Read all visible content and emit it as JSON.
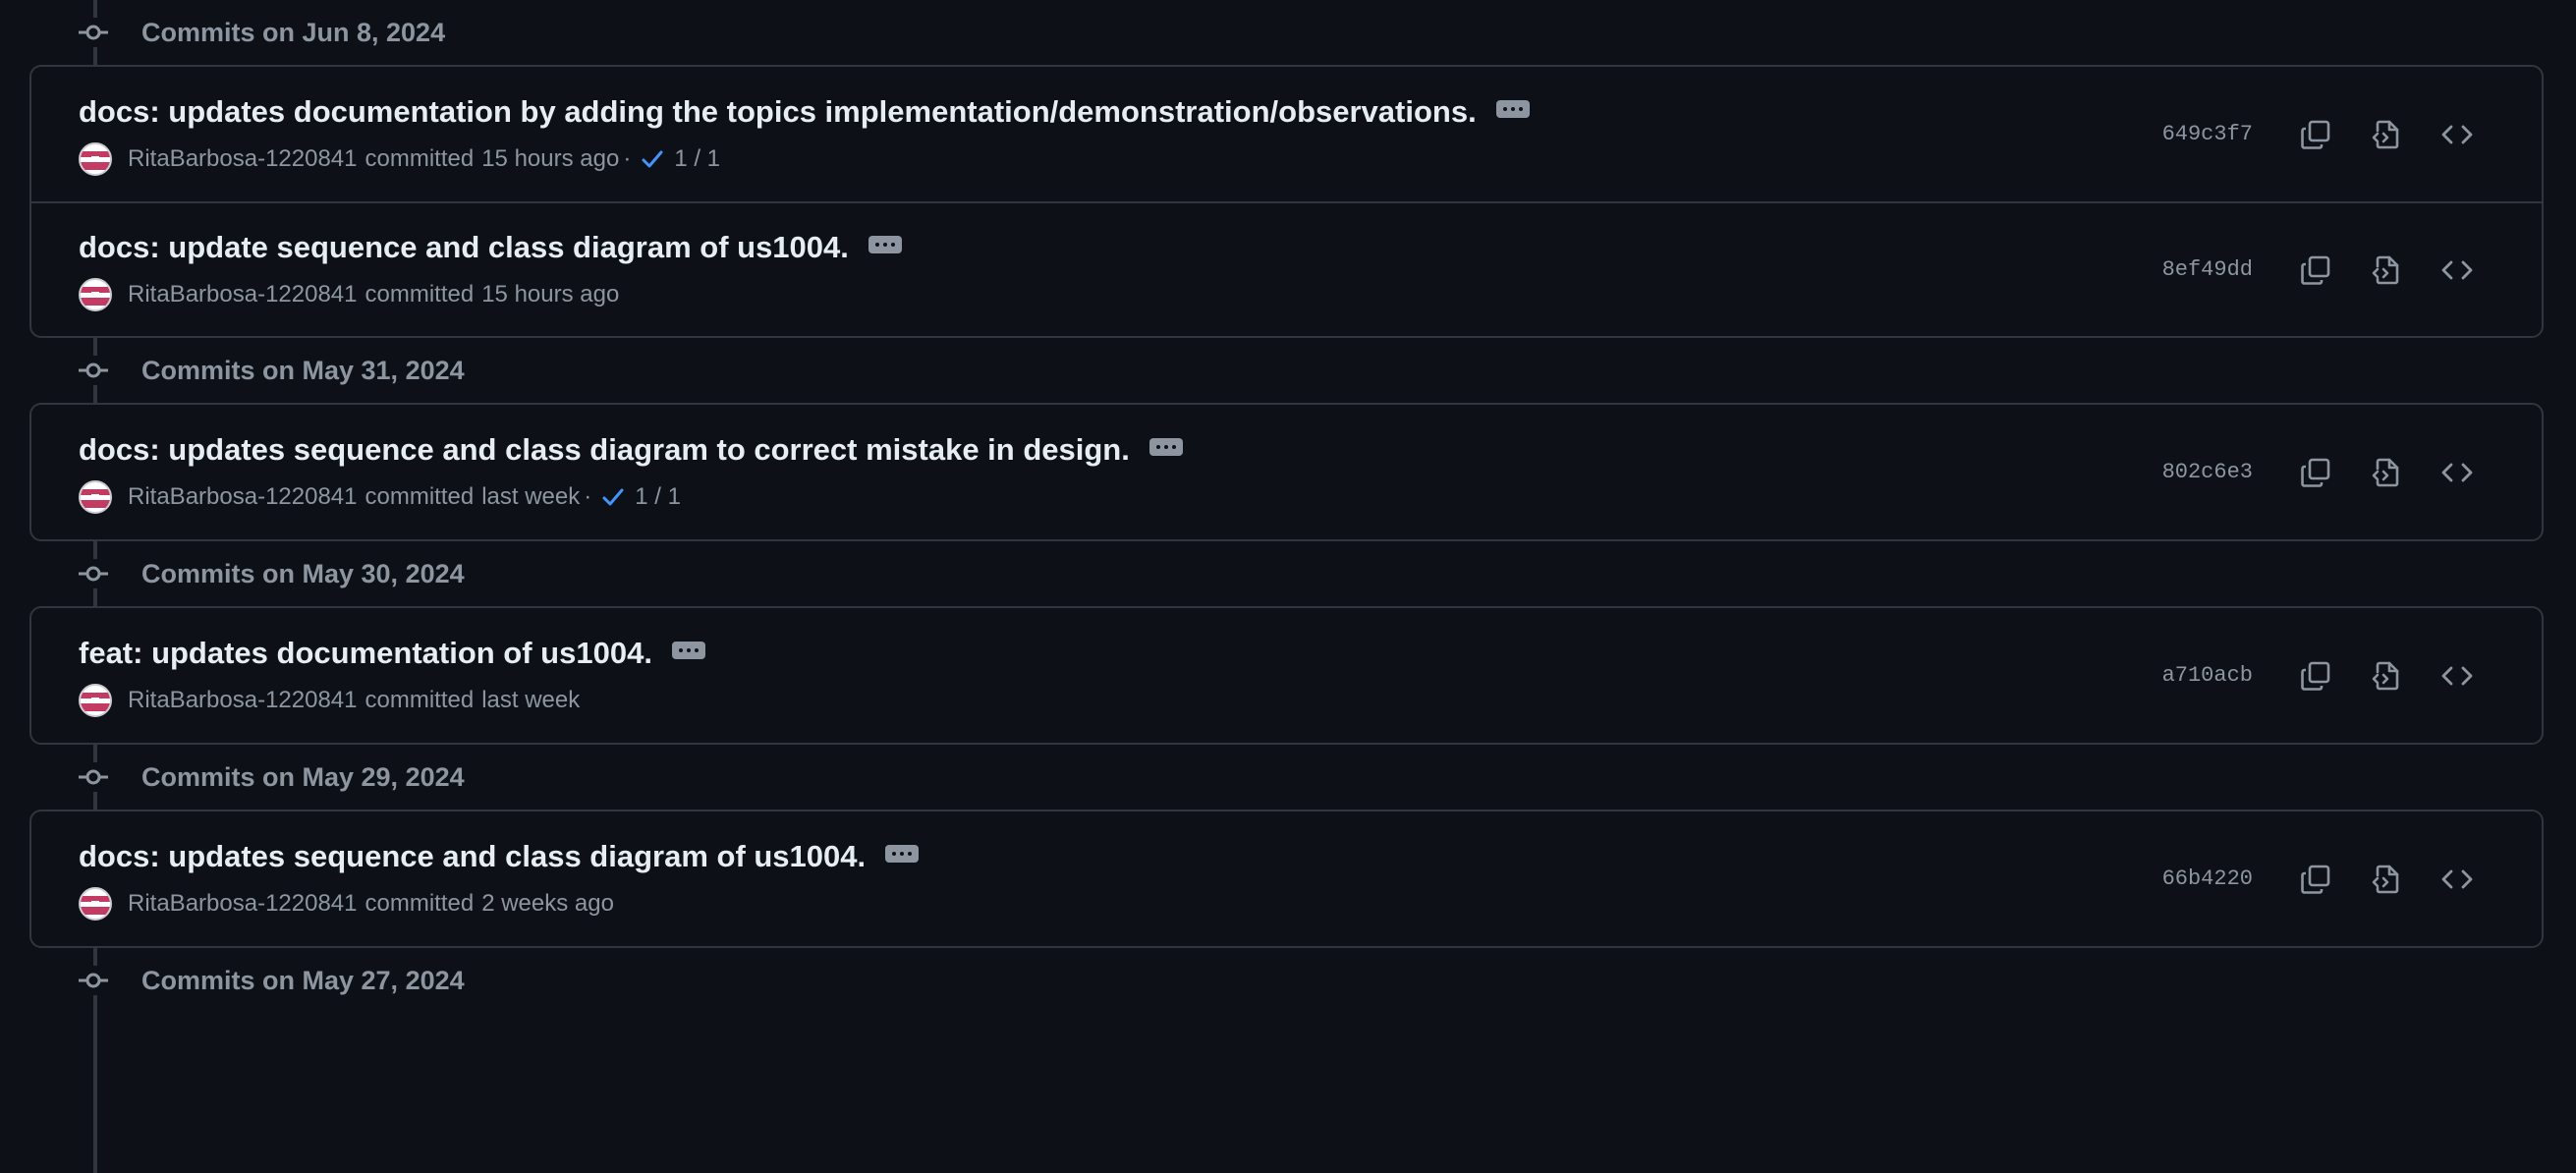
{
  "groups": [
    {
      "date_label": "Commits on Jun 8, 2024",
      "commits": [
        {
          "title": "docs: updates documentation by adding the topics implementation/demonstration/observations.",
          "author": "RitaBarbosa-1220841",
          "committed_text": "committed",
          "time": "15 hours ago",
          "check_sep": "·",
          "checks": "1 / 1",
          "sha": "649c3f7"
        },
        {
          "title": "docs: update sequence and class diagram of us1004.",
          "author": "RitaBarbosa-1220841",
          "committed_text": "committed",
          "time": "15 hours ago",
          "sha": "8ef49dd"
        }
      ]
    },
    {
      "date_label": "Commits on May 31, 2024",
      "commits": [
        {
          "title": "docs: updates sequence and class diagram to correct mistake in design.",
          "author": "RitaBarbosa-1220841",
          "committed_text": "committed",
          "time": "last week",
          "check_sep": "·",
          "checks": "1 / 1",
          "sha": "802c6e3"
        }
      ]
    },
    {
      "date_label": "Commits on May 30, 2024",
      "commits": [
        {
          "title": "feat: updates documentation of us1004.",
          "author": "RitaBarbosa-1220841",
          "committed_text": "committed",
          "time": "last week",
          "sha": "a710acb"
        }
      ]
    },
    {
      "date_label": "Commits on May 29, 2024",
      "commits": [
        {
          "title": "docs: updates sequence and class diagram of us1004.",
          "author": "RitaBarbosa-1220841",
          "committed_text": "committed",
          "time": "2 weeks ago",
          "sha": "66b4220"
        }
      ]
    },
    {
      "date_label": "Commits on May 27, 2024",
      "commits": []
    }
  ],
  "icons": {
    "commit_node": "git-commit-icon",
    "ellipsis": "kebab-horizontal-icon",
    "check": "check-icon",
    "copy": "copy-icon",
    "browse": "file-code-icon",
    "code": "code-icon"
  },
  "colors": {
    "background": "#0d1117",
    "border": "#30363d",
    "text_primary": "#e6edf3",
    "text_muted": "#8d96a0",
    "check": "#4493f8",
    "avatar_accent": "#c33a62"
  }
}
